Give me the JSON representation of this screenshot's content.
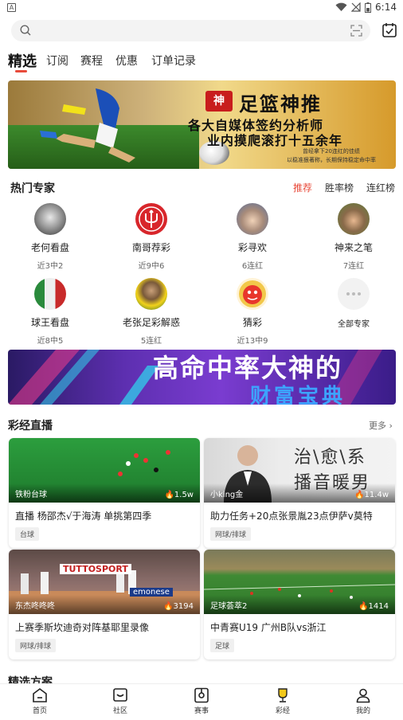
{
  "status": {
    "indicator": "A",
    "time": "6:14"
  },
  "search": {
    "placeholder": ""
  },
  "tabs": [
    {
      "label": "精选",
      "active": true
    },
    {
      "label": "订阅"
    },
    {
      "label": "赛程"
    },
    {
      "label": "优惠"
    },
    {
      "label": "订单记录"
    }
  ],
  "banner1": {
    "logo": "神",
    "title": "足篮神推",
    "line1": "各大自媒体签约分析师",
    "line2": "业内摸爬滚打十五余年",
    "note1": "曾经拿下20连红的佳绩",
    "note2": "以稳准狠著称，长期保持稳定命中率"
  },
  "hot_experts": {
    "title": "热门专家",
    "filters": [
      "推荐",
      "胜率榜",
      "连红榜"
    ],
    "experts": [
      {
        "name": "老何看盘",
        "record": "近3中2"
      },
      {
        "name": "南哥荐彩",
        "record": "近9中6"
      },
      {
        "name": "彩寻欢",
        "record": "6连红"
      },
      {
        "name": "神来之笔",
        "record": "7连红"
      },
      {
        "name": "球王看盘",
        "record": "近8中5"
      },
      {
        "name": "老张足彩解惑",
        "record": "5连红"
      },
      {
        "name": "猜彩",
        "record": "近13中9"
      }
    ],
    "all_label": "全部专家"
  },
  "banner2": {
    "line1": "高命中率大神的",
    "line2": "财富宝典"
  },
  "live": {
    "title": "彩经直播",
    "more": "更多",
    "cards": [
      {
        "anchor": "铁粉台球",
        "heat": "1.5w",
        "title": "直播 杨邵杰√于海涛 单挑第四季",
        "tag": "台球"
      },
      {
        "anchor": "小king金",
        "heat": "11.4w",
        "title": "助力任务+20点张景胤23点伊萨v莫特",
        "tag": "网球/排球"
      },
      {
        "anchor": "东杰咚咚咚",
        "heat": "3194",
        "title": "上赛季斯坎迪奇对阵基耶里录像",
        "tag": "网球/排球"
      },
      {
        "anchor": "足球荟萃2",
        "heat": "1414",
        "title": "中青赛U19 广州B队vs浙江",
        "tag": "足球"
      }
    ],
    "thumb_texts": {
      "voice_1": "治\\愈\\系",
      "voice_2": "播音暖男",
      "sponsor_1": "TUTTOSPORT",
      "sponsor_2": "emonese"
    }
  },
  "picks": {
    "title": "精选方案"
  },
  "bottom_nav": [
    {
      "label": "首页",
      "icon": "home-icon"
    },
    {
      "label": "社区",
      "icon": "community-icon"
    },
    {
      "label": "赛事",
      "icon": "match-icon"
    },
    {
      "label": "彩经",
      "icon": "trophy-icon"
    },
    {
      "label": "我的",
      "icon": "profile-icon"
    }
  ],
  "colors": {
    "accent": "#e84a3a",
    "background": "#f4f4f4"
  }
}
